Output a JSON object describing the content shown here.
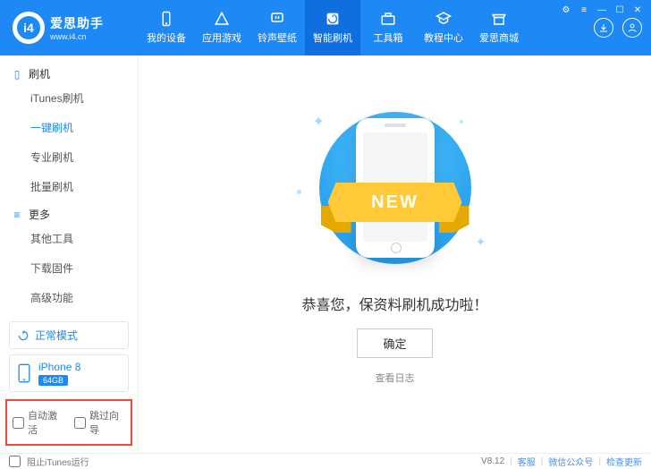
{
  "app": {
    "name": "爱思助手",
    "url": "www.i4.cn",
    "logo_text": "i4"
  },
  "window_ctrl": {
    "cart": "⚙",
    "menu": "≡",
    "min": "—",
    "max": "☐",
    "close": "✕"
  },
  "nav": [
    {
      "label": "我的设备",
      "icon": "device"
    },
    {
      "label": "应用游戏",
      "icon": "apps"
    },
    {
      "label": "铃声壁纸",
      "icon": "music"
    },
    {
      "label": "智能刷机",
      "icon": "flash",
      "active": true
    },
    {
      "label": "工具箱",
      "icon": "tools"
    },
    {
      "label": "教程中心",
      "icon": "edu"
    },
    {
      "label": "爱思商城",
      "icon": "shop"
    }
  ],
  "sidebar": {
    "group1": {
      "title": "刷机",
      "items": [
        "iTunes刷机",
        "一键刷机",
        "专业刷机",
        "批量刷机"
      ],
      "active_index": 1
    },
    "group2": {
      "title": "更多",
      "items": [
        "其他工具",
        "下载固件",
        "高级功能"
      ]
    },
    "mode": "正常模式",
    "device": {
      "name": "iPhone 8",
      "storage": "64GB"
    },
    "check1": "自动激活",
    "check2": "跳过向导"
  },
  "main": {
    "ribbon": "NEW",
    "message": "恭喜您，保资料刷机成功啦！",
    "ok": "确定",
    "log": "查看日志"
  },
  "footer": {
    "block_itunes": "阻止iTunes运行",
    "version": "V8.12",
    "support": "客服",
    "wechat": "微信公众号",
    "update": "检查更新"
  }
}
